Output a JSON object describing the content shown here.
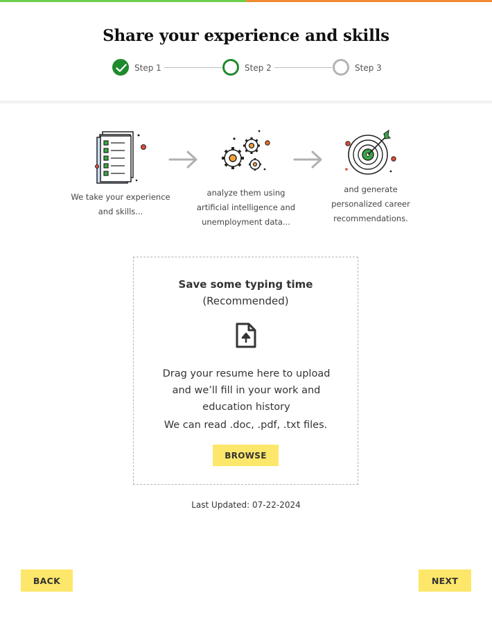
{
  "progress": {
    "percent": 50,
    "fill_color": "#6bcf4d",
    "track_color": "#f08a30"
  },
  "page": {
    "title": "Share your experience and skills"
  },
  "steps": [
    {
      "label": "Step 1",
      "state": "completed"
    },
    {
      "label": "Step 2",
      "state": "current"
    },
    {
      "label": "Step 3",
      "state": "upcoming"
    }
  ],
  "features": [
    {
      "icon": "checklist-document-icon",
      "line1": "We take your experience",
      "line2": "and skills..."
    },
    {
      "icon": "gears-icon",
      "line1": "analyze them using",
      "line2": "artificial intelligence and",
      "line3": "unemployment data..."
    },
    {
      "icon": "target-icon",
      "line1": "and generate",
      "line2": "personalized career",
      "line3": "recommendations."
    }
  ],
  "upload": {
    "title": "Save some typing time",
    "subtitle": "(Recommended)",
    "icon": "file-upload-icon",
    "line1": "Drag your resume here to upload",
    "line2": "and we’ll fill in your work and",
    "line3": "education history",
    "formats": "We can read .doc, .pdf, .txt files.",
    "browse_label": "BROWSE"
  },
  "last_updated": "Last Updated: 07-22-2024",
  "navigation": {
    "back_label": "BACK",
    "next_label": "NEXT"
  },
  "colors": {
    "accent_green": "#1e8a2c",
    "button_yellow": "#fde76a",
    "inactive_grey": "#b3b3b3"
  }
}
